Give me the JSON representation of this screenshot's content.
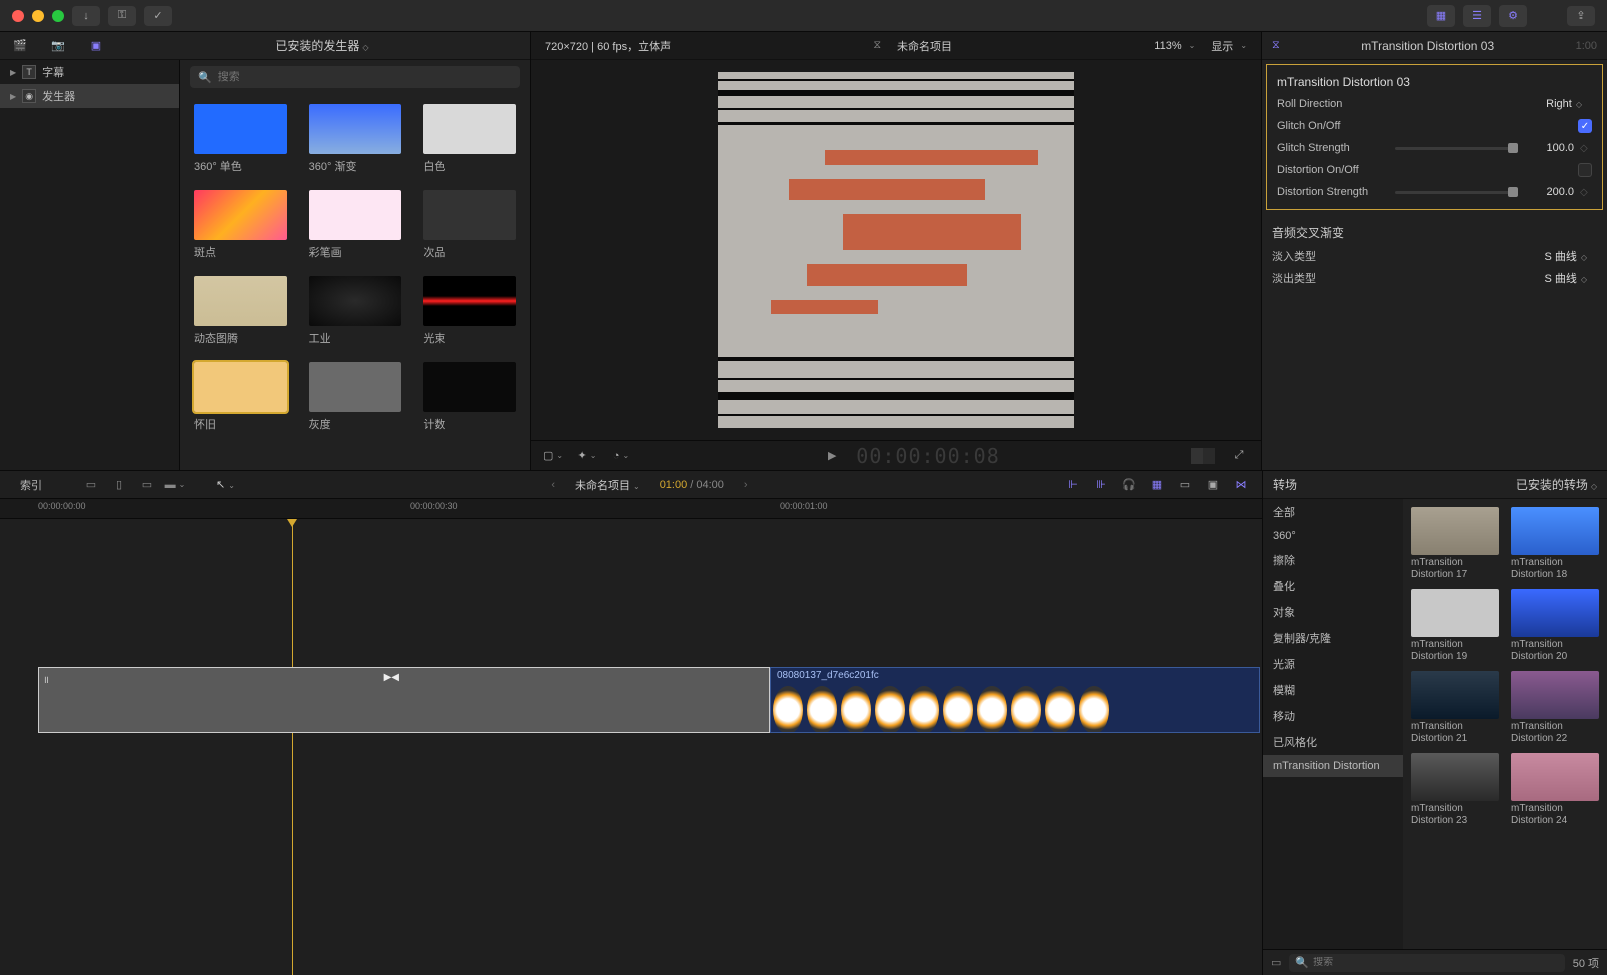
{
  "titlebar": {
    "share_tooltip": "共享"
  },
  "browser": {
    "title": "已安装的发生器",
    "sidebar": [
      {
        "label": "字幕",
        "letter": "T",
        "selected": false
      },
      {
        "label": "发生器",
        "letter": "◉",
        "selected": true
      }
    ],
    "search_placeholder": "搜索",
    "thumbs": [
      {
        "label": "360° 单色",
        "bg": "#226bff"
      },
      {
        "label": "360° 渐变",
        "bg": "linear-gradient(180deg,#3a6cff,#88aee0)"
      },
      {
        "label": "白色",
        "bg": "#d9d9d9"
      },
      {
        "label": "斑点",
        "bg": "linear-gradient(135deg,#ff3a60,#ffb020,#ff5a90)"
      },
      {
        "label": "彩笔画",
        "bg": "#fde6f3"
      },
      {
        "label": "次品",
        "bg": "#b0b0a8 url() , linear-gradient(#b0b0a8,#b0b0a8)"
      },
      {
        "label": "动态图腾",
        "bg": "linear-gradient(#d3c6a2,#cbbd95)"
      },
      {
        "label": "工业",
        "bg": "radial-gradient(ellipse at center,#2a2a2a,#0a0a0a)"
      },
      {
        "label": "光束",
        "bg": "linear-gradient(180deg,#000 40%,#ff2020 50%,#000 60%)"
      },
      {
        "label": "怀旧",
        "bg": "#f2c87a",
        "selected": true
      },
      {
        "label": "灰度",
        "bg": "#6a6a6a"
      },
      {
        "label": "计数",
        "bg": "#0a0a0a"
      }
    ]
  },
  "viewer": {
    "format": "720×720 | 60 fps，立体声",
    "project": "未命名项目",
    "zoom": "113%",
    "display": "显示",
    "timecode": "00:00:00:08",
    "play_symbol": "▶"
  },
  "inspector": {
    "title": "mTransition Distortion 03",
    "header_tc": "1:00",
    "section_title": "mTransition Distortion 03",
    "params": {
      "roll_direction_label": "Roll Direction",
      "roll_direction_value": "Right",
      "glitch_onoff_label": "Glitch On/Off",
      "glitch_onoff_value": true,
      "glitch_strength_label": "Glitch Strength",
      "glitch_strength_value": "100.0",
      "distortion_onoff_label": "Distortion On/Off",
      "distortion_onoff_value": false,
      "distortion_strength_label": "Distortion Strength",
      "distortion_strength_value": "200.0"
    },
    "audio": {
      "header": "音频交叉渐变",
      "fade_in_label": "淡入类型",
      "fade_in_value": "S 曲线",
      "fade_out_label": "淡出类型",
      "fade_out_value": "S 曲线"
    }
  },
  "timeline": {
    "index": "索引",
    "project": "未命名项目",
    "current_time": "01:00",
    "duration": "/ 04:00",
    "ruler": [
      "00:00:00:00",
      "00:00:00:30",
      "00:00:01:00"
    ],
    "clip_name": "08080137_d7e6c201fc"
  },
  "transitions": {
    "header": "转场",
    "installed": "已安装的转场",
    "categories": [
      "全部",
      "360°",
      "擦除",
      "叠化",
      "对象",
      "复制器/克隆",
      "光源",
      "模糊",
      "移动",
      "已风格化",
      "mTransition Distortion"
    ],
    "selected_category": "mTransition Distortion",
    "items": [
      {
        "name": "mTransition Distortion 17",
        "bg": "linear-gradient(#a8a090,#888070)"
      },
      {
        "name": "mTransition Distortion 18",
        "bg": "linear-gradient(#4a90ff,#2a60cc)"
      },
      {
        "name": "mTransition Distortion 19",
        "bg": "#c8c8c8"
      },
      {
        "name": "mTransition Distortion 20",
        "bg": "linear-gradient(#3a6aff,#1a3a99)"
      },
      {
        "name": "mTransition Distortion 21",
        "bg": "linear-gradient(#2a3a4a,#0a1a2a)"
      },
      {
        "name": "mTransition Distortion 22",
        "bg": "linear-gradient(#8a5a90,#4a3a60)"
      },
      {
        "name": "mTransition Distortion 23",
        "bg": "linear-gradient(#5a5a5a,#2a2a2a)"
      },
      {
        "name": "mTransition Distortion 24",
        "bg": "linear-gradient(#c88aa0,#a86a80)"
      }
    ],
    "search_placeholder": "搜索",
    "count": "50 项"
  }
}
